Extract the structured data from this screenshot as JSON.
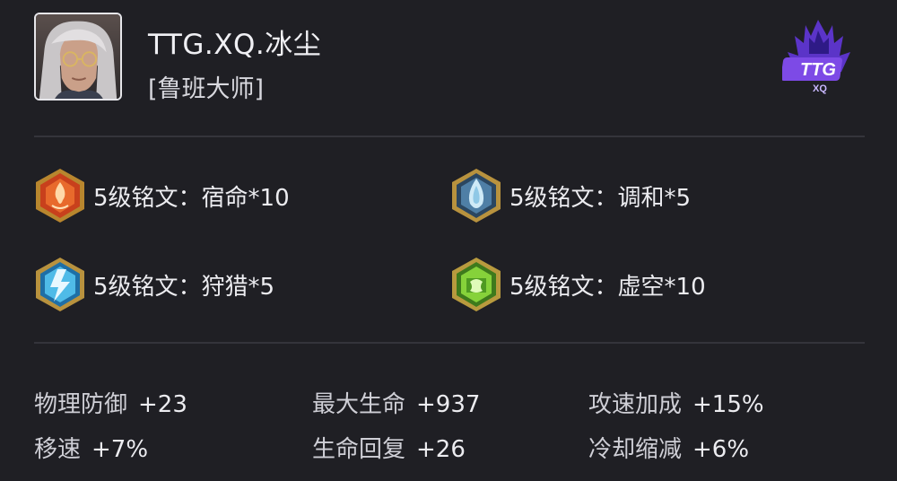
{
  "player": {
    "name": "TTG.XQ.冰尘",
    "hero": "[鲁班大师]"
  },
  "team_logo": {
    "text": "TTG",
    "subtext": "XQ",
    "color": "#6a3cd8"
  },
  "runes": [
    {
      "label": "5级铭文：宿命*10",
      "icon": "destiny-rune-icon",
      "color": "#e0572a"
    },
    {
      "label": "5级铭文：调和*5",
      "icon": "harmony-rune-icon",
      "color": "#7fb2cf"
    },
    {
      "label": "5级铭文：狩猎*5",
      "icon": "hunt-rune-icon",
      "color": "#4fb7e6"
    },
    {
      "label": "5级铭文：虚空*10",
      "icon": "void-rune-icon",
      "color": "#7fcf3a"
    }
  ],
  "stats": [
    {
      "name": "物理防御",
      "value": "+23"
    },
    {
      "name": "最大生命",
      "value": "+937"
    },
    {
      "name": "攻速加成",
      "value": "+15%"
    },
    {
      "name": "移速",
      "value": "+7%"
    },
    {
      "name": "生命回复",
      "value": "+26"
    },
    {
      "name": "冷却缩减",
      "value": "+6%"
    }
  ]
}
